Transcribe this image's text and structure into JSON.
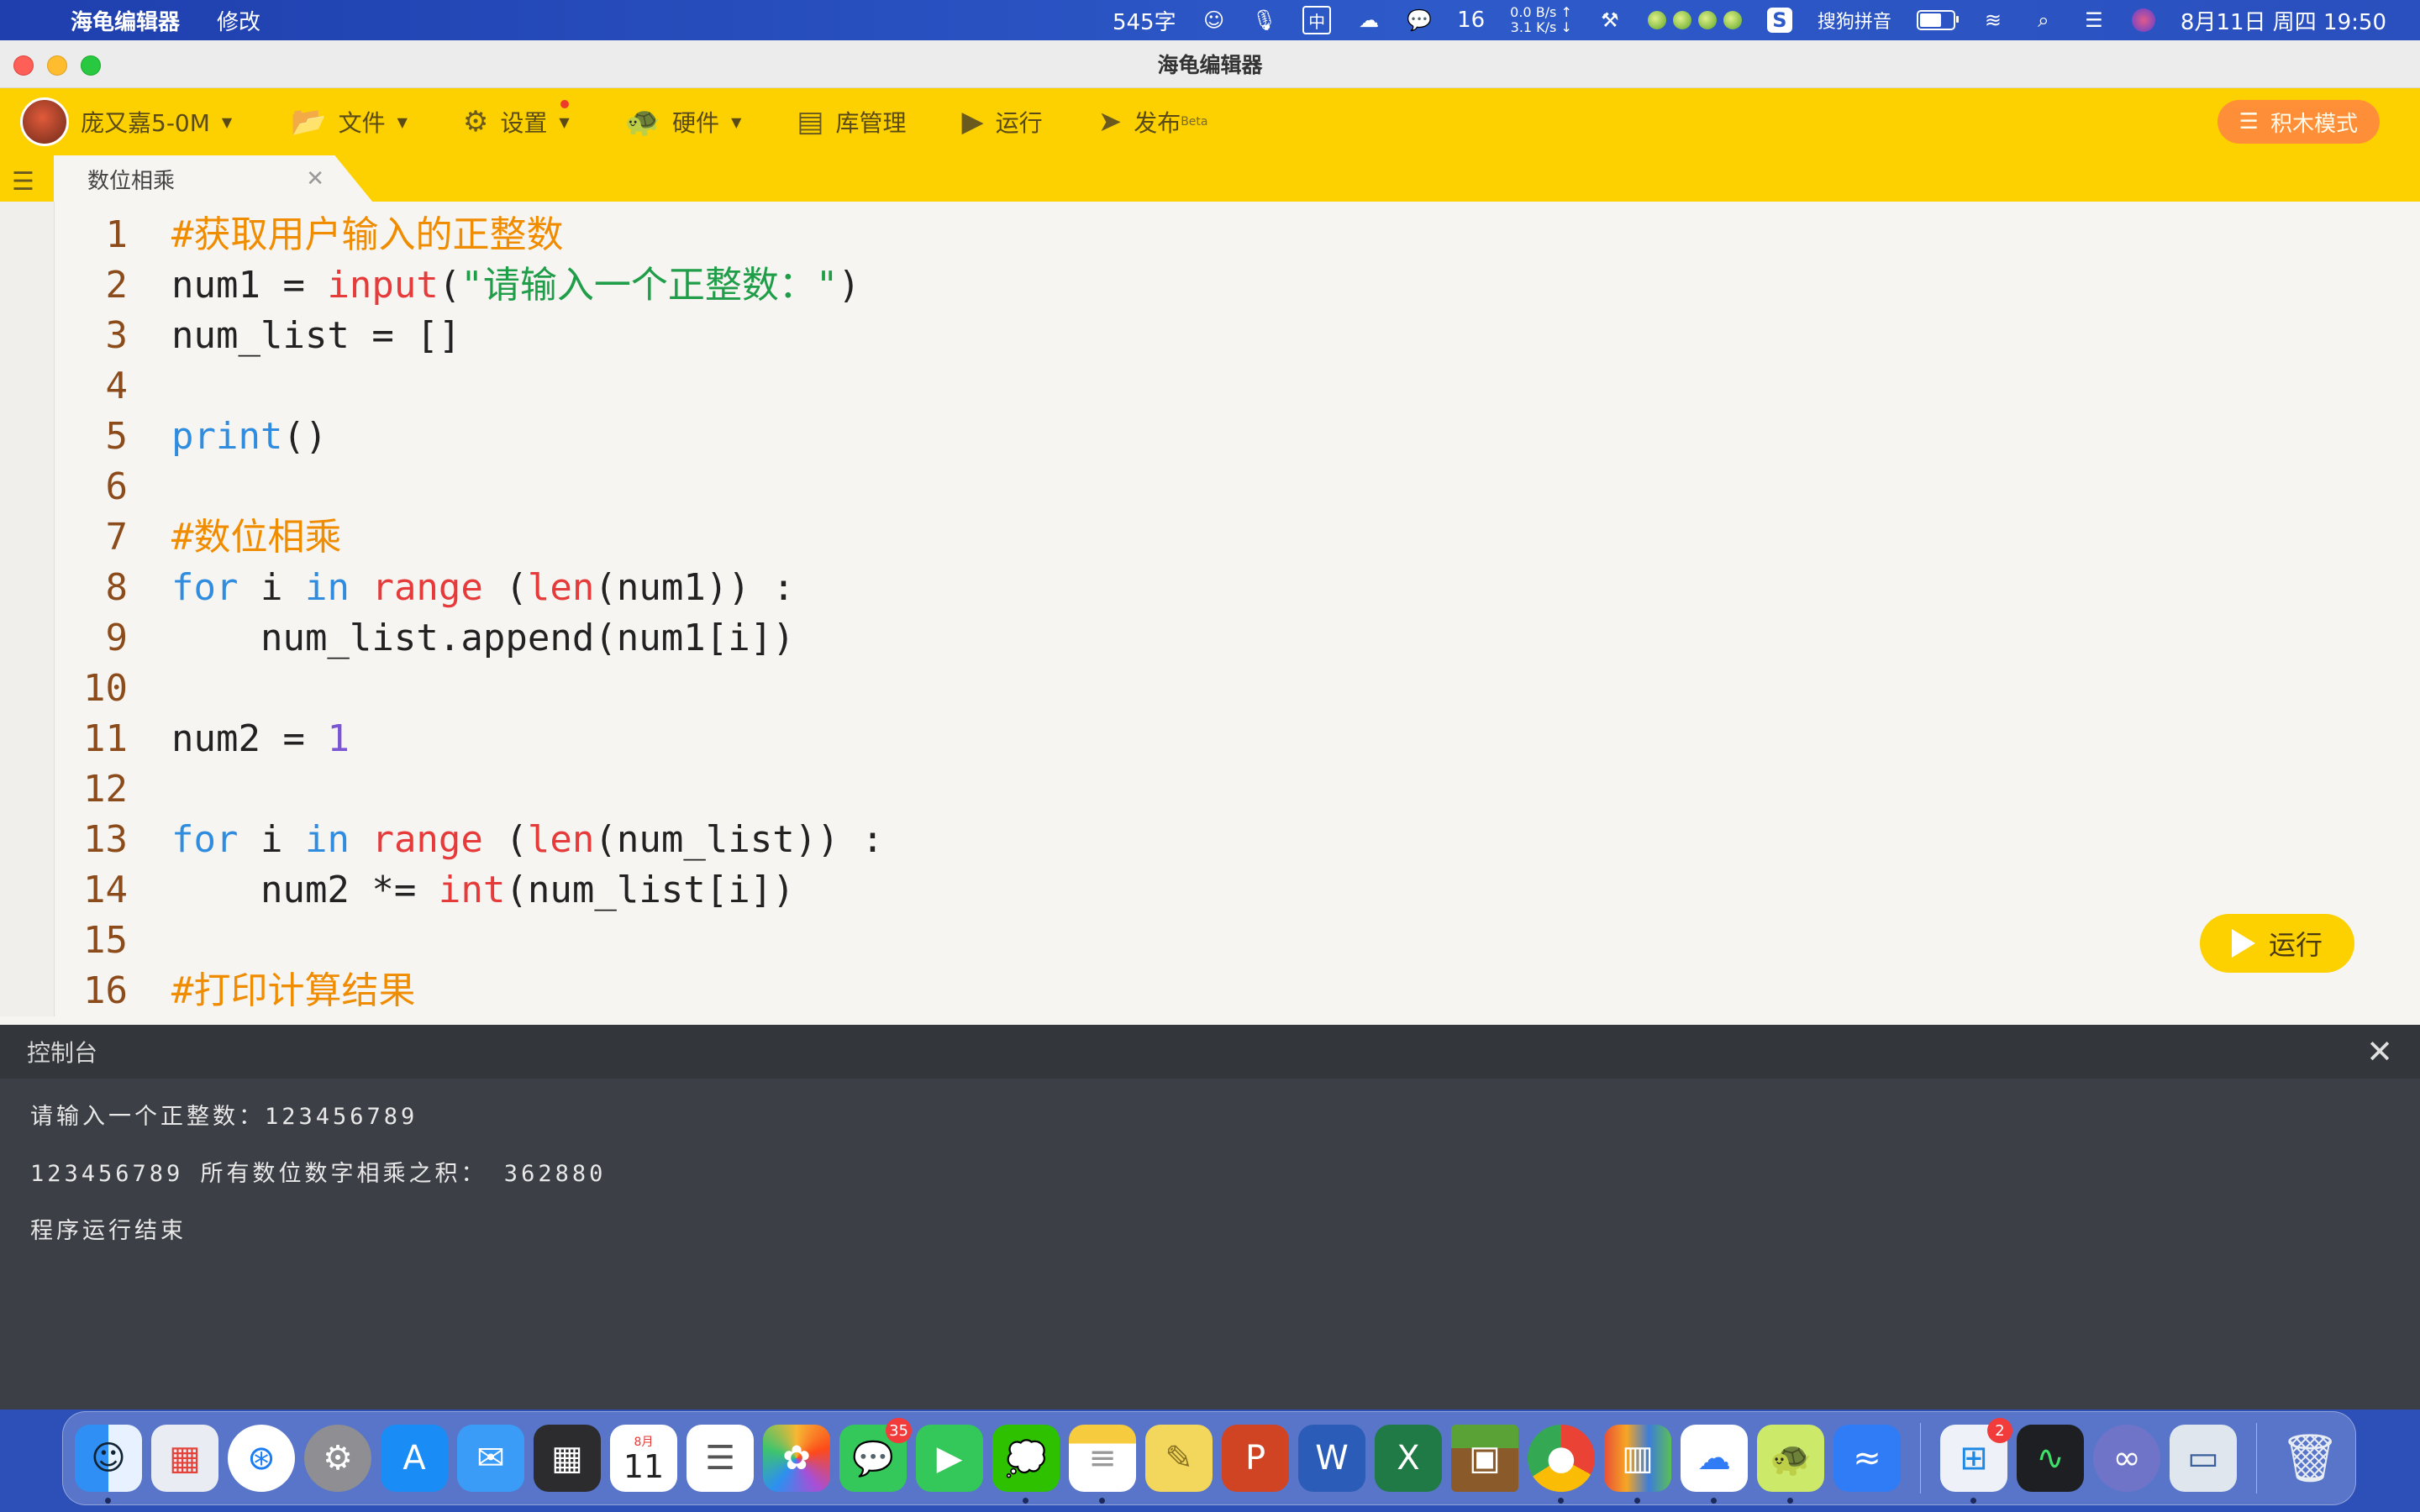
{
  "menubar": {
    "app_name": "海龟编辑器",
    "menu_edit": "修改",
    "word_count": "545字",
    "input_method_cn": "中",
    "wechat_count": "16",
    "net_up": "0.0 B/s ↑",
    "net_down": "3.1 K/s ↓",
    "ime_name": "搜狗拼音",
    "datetime": "8月11日 周四  19:50",
    "battery_level": 0.65
  },
  "window": {
    "title": "海龟编辑器"
  },
  "toolbar": {
    "user_name": "庞又嘉5-0M",
    "file_label": "文件",
    "settings_label": "设置",
    "hardware_label": "硬件",
    "library_label": "库管理",
    "run_label": "运行",
    "publish_label": "发布",
    "publish_badge": "Beta",
    "block_mode_label": "积木模式"
  },
  "tab": {
    "title": "数位相乘"
  },
  "editor": {
    "line_numbers": [
      "1",
      "2",
      "3",
      "4",
      "5",
      "6",
      "7",
      "8",
      "9",
      "10",
      "11",
      "12",
      "13",
      "14",
      "15",
      "16"
    ],
    "run_button_label": "运行"
  },
  "console": {
    "title": "控制台",
    "lines": [
      "请输入一个正整数：123456789",
      "123456789 所有数位数字相乘之积： 362880",
      "程序运行结束"
    ]
  },
  "dock": {
    "calendar_month": "8月",
    "calendar_day": "11",
    "messages_badge": "35",
    "store_badge": "2"
  },
  "colors": {
    "accent_yellow": "#fdd000",
    "block_mode_orange": "#ff8a3d",
    "comment": "#f08c00",
    "keyword": "#2f8cde",
    "builtin": "#e63b3b",
    "string": "#1f9d48",
    "number": "#7a55d4"
  }
}
